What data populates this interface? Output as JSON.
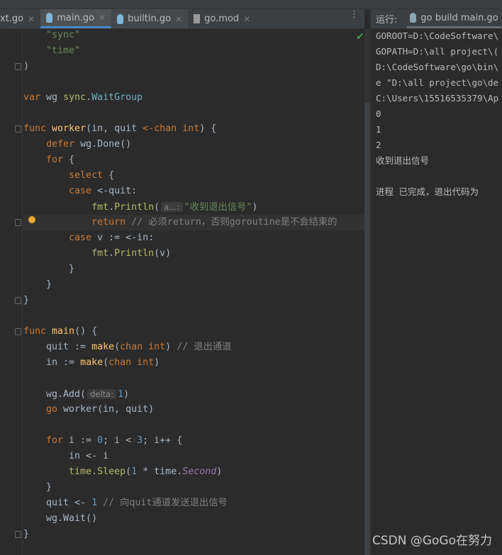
{
  "tabs": [
    {
      "label": "xt.go"
    },
    {
      "label": "main.go",
      "active": true
    },
    {
      "label": "builtin.go"
    },
    {
      "label": "go.mod"
    }
  ],
  "run": {
    "label": "运行:",
    "tab": "go build main.go",
    "output": [
      "GOROOT=D:\\CodeSoftware\\",
      "GOPATH=D:\\all project\\(",
      "D:\\CodeSoftware\\go\\bin\\",
      "e \"D:\\all project\\go\\de",
      "C:\\Users\\15516535379\\Ap",
      "0",
      "1",
      "2",
      "收到退出信号",
      "",
      "进程 已完成，退出代码为"
    ]
  },
  "code": [
    [
      [
        1,
        "\"sync\"",
        "s"
      ]
    ],
    [
      [
        1,
        "\"time\"",
        "s"
      ]
    ],
    [
      [
        0,
        ")",
        "d"
      ]
    ],
    [],
    [
      [
        0,
        "var ",
        "k"
      ],
      [
        0,
        "wg ",
        "d"
      ],
      [
        0,
        "sync",
        "p"
      ],
      [
        0,
        ".",
        "d"
      ],
      [
        0,
        "WaitGroup",
        "t"
      ]
    ],
    [],
    [
      [
        0,
        "func ",
        "k"
      ],
      [
        0,
        "worker",
        "f"
      ],
      [
        0,
        "(in, quit ",
        "d"
      ],
      [
        0,
        "<-chan int",
        "k"
      ],
      [
        0,
        ") {",
        "d"
      ]
    ],
    [
      [
        1,
        "defer ",
        "k"
      ],
      [
        0,
        "wg.Done()",
        "d"
      ]
    ],
    [
      [
        1,
        "for ",
        "k"
      ],
      [
        0,
        "{",
        "d"
      ]
    ],
    [
      [
        2,
        "select ",
        "k"
      ],
      [
        0,
        "{",
        "d"
      ]
    ],
    [
      [
        2,
        "case ",
        "k"
      ],
      [
        0,
        "<-quit:",
        "d"
      ]
    ],
    [
      [
        3,
        "fmt",
        "p"
      ],
      [
        0,
        ".",
        "d"
      ],
      [
        0,
        "Println",
        "p"
      ],
      [
        0,
        "(",
        "d"
      ],
      [
        0,
        "a…:",
        "hint"
      ],
      [
        0,
        "\"收到退出信号\"",
        "s"
      ],
      [
        0,
        ")",
        "d"
      ]
    ],
    [
      [
        3,
        "return ",
        "k"
      ],
      [
        0,
        "// 必须return，否则goroutine是不会结束的",
        "c"
      ]
    ],
    [
      [
        2,
        "case ",
        "k"
      ],
      [
        0,
        "v := <-in:",
        "d"
      ]
    ],
    [
      [
        3,
        "fmt",
        "p"
      ],
      [
        0,
        ".",
        "d"
      ],
      [
        0,
        "Println",
        "p"
      ],
      [
        0,
        "(v)",
        "d"
      ]
    ],
    [
      [
        2,
        "}",
        "d"
      ]
    ],
    [
      [
        1,
        "}",
        "d"
      ]
    ],
    [
      [
        0,
        "}",
        "d"
      ]
    ],
    [],
    [
      [
        0,
        "func ",
        "k"
      ],
      [
        0,
        "main",
        "f"
      ],
      [
        0,
        "() {",
        "d"
      ]
    ],
    [
      [
        1,
        "quit := ",
        "d"
      ],
      [
        0,
        "make",
        "f"
      ],
      [
        0,
        "(",
        "d"
      ],
      [
        0,
        "chan int",
        "k"
      ],
      [
        0,
        ") ",
        "d"
      ],
      [
        0,
        "// 退出通道",
        "c"
      ]
    ],
    [
      [
        1,
        "in := ",
        "d"
      ],
      [
        0,
        "make",
        "f"
      ],
      [
        0,
        "(",
        "d"
      ],
      [
        0,
        "chan int",
        "k"
      ],
      [
        0,
        ")",
        "d"
      ]
    ],
    [],
    [
      [
        1,
        "wg.Add(",
        "d"
      ],
      [
        0,
        "delta:",
        "hint"
      ],
      [
        0,
        "1",
        "n"
      ],
      [
        0,
        ")",
        "d"
      ]
    ],
    [
      [
        1,
        "go ",
        "k"
      ],
      [
        0,
        "worker(in, quit)",
        "d"
      ]
    ],
    [],
    [
      [
        1,
        "for ",
        "k"
      ],
      [
        0,
        "i := ",
        "d"
      ],
      [
        0,
        "0",
        "n"
      ],
      [
        0,
        "; i < ",
        "d"
      ],
      [
        0,
        "3",
        "n"
      ],
      [
        0,
        "; i++ {",
        "d"
      ]
    ],
    [
      [
        2,
        "in <- i",
        "d"
      ]
    ],
    [
      [
        2,
        "time",
        "p"
      ],
      [
        0,
        ".",
        "d"
      ],
      [
        0,
        "Sleep",
        "p"
      ],
      [
        0,
        "(",
        "d"
      ],
      [
        0,
        "1",
        "n"
      ],
      [
        0,
        " * time.",
        "d"
      ],
      [
        0,
        "Second",
        "i"
      ],
      [
        0,
        ")",
        "d"
      ]
    ],
    [
      [
        1,
        "}",
        "d"
      ]
    ],
    [
      [
        1,
        "quit <- ",
        "d"
      ],
      [
        0,
        "1",
        "n"
      ],
      [
        0,
        " ",
        "d"
      ],
      [
        0,
        "// 向quit通道发送退出信号",
        "c"
      ]
    ],
    [
      [
        1,
        "wg.Wait()",
        "d"
      ]
    ],
    [
      [
        0,
        "}",
        "d"
      ]
    ]
  ],
  "watermark": "CSDN @GoGo在努力"
}
